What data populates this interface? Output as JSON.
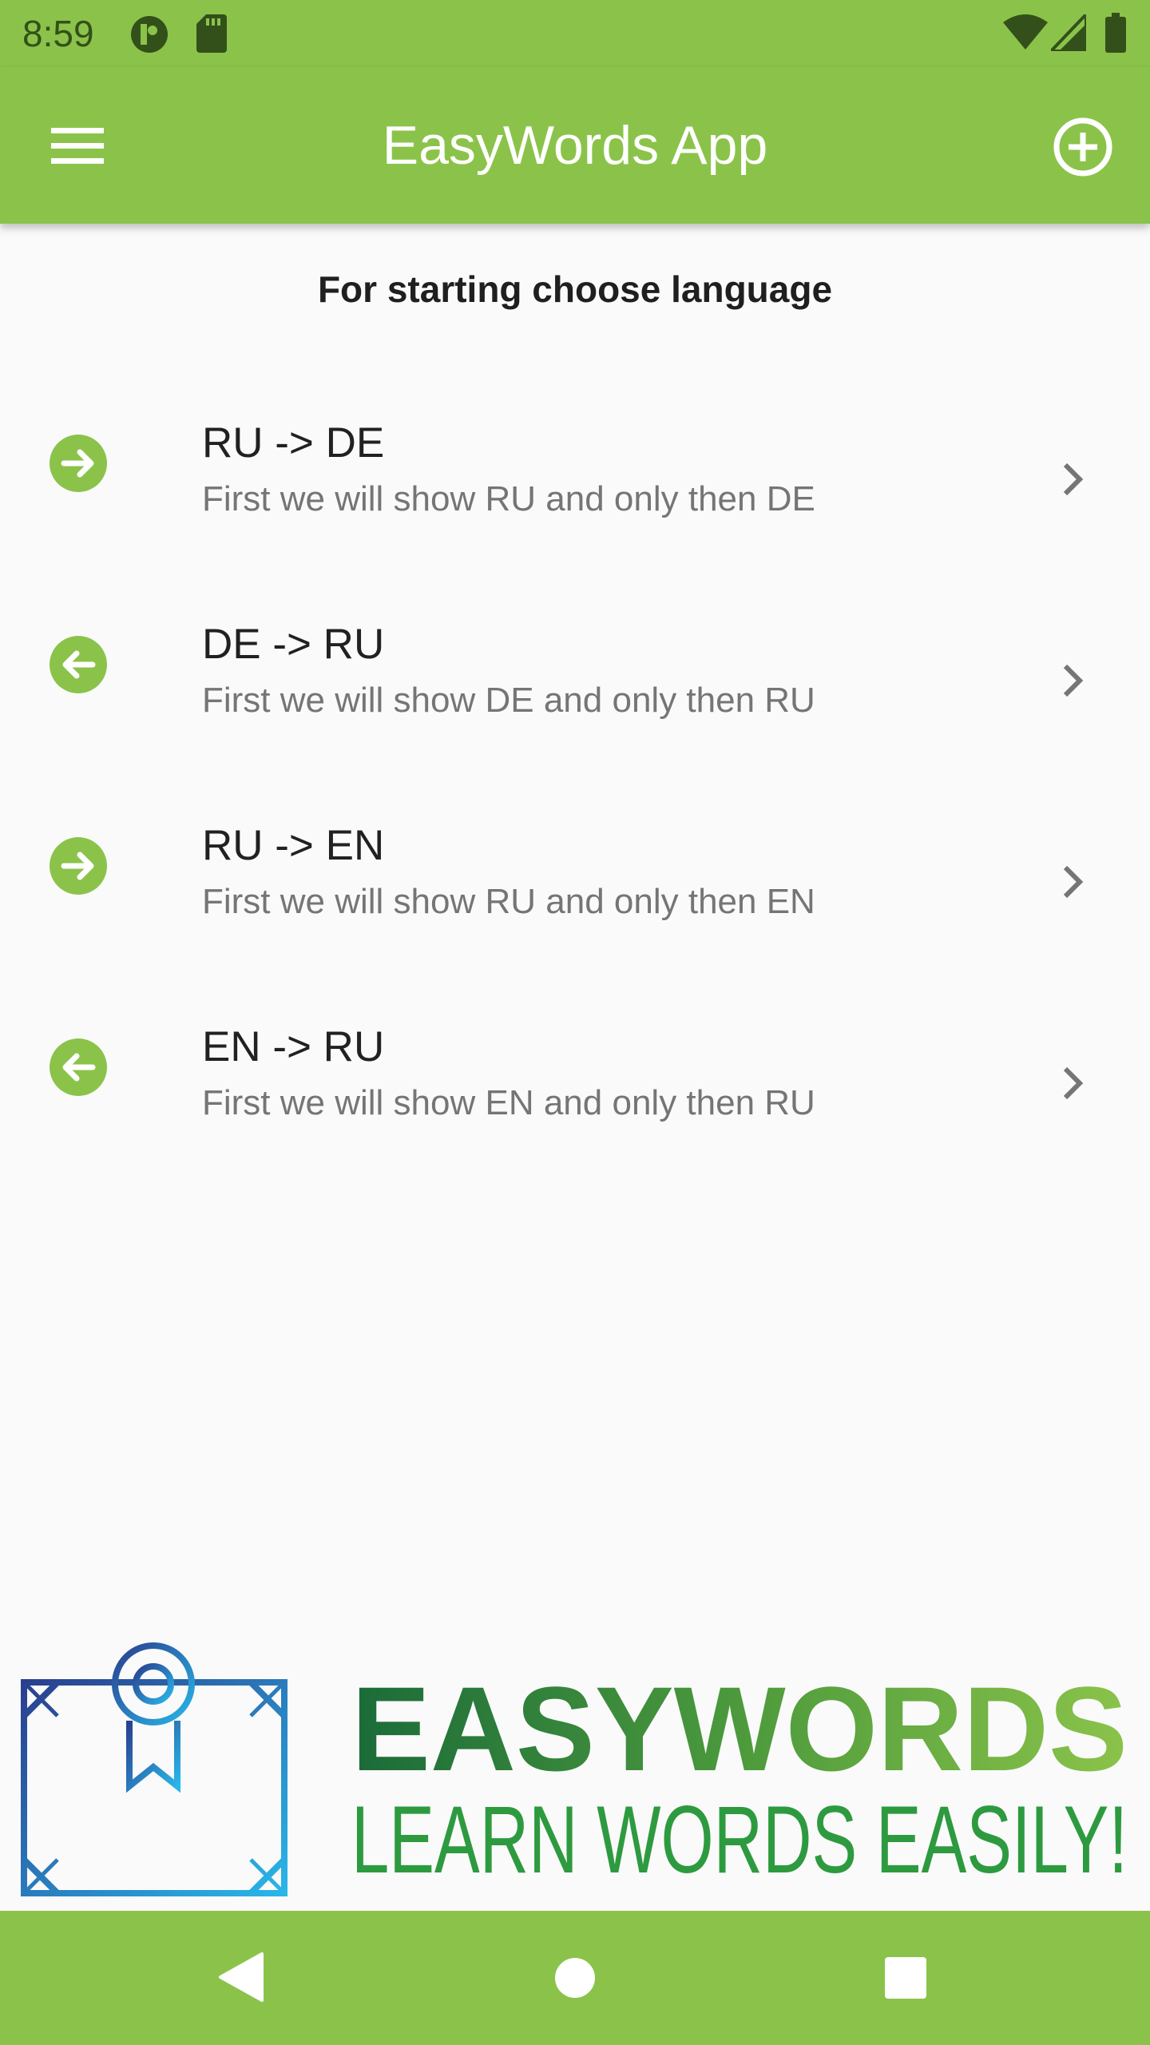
{
  "status_bar": {
    "time": "8:59",
    "icons": [
      "notification-app-icon",
      "sd-card-icon",
      "wifi-icon",
      "signal-icon",
      "battery-icon"
    ]
  },
  "app_bar": {
    "title": "EasyWords App",
    "menu_icon": "menu-icon",
    "add_icon": "add-circle-icon"
  },
  "main": {
    "heading": "For starting choose language",
    "items": [
      {
        "title": "RU -> DE",
        "subtitle": "First we will show RU and only then DE",
        "icon": "arrow-right-circle-icon"
      },
      {
        "title": "DE -> RU",
        "subtitle": "First we will show DE and only then RU",
        "icon": "arrow-left-circle-icon"
      },
      {
        "title": "RU -> EN",
        "subtitle": "First we will show RU and only then EN",
        "icon": "arrow-right-circle-icon"
      },
      {
        "title": "EN -> RU",
        "subtitle": "First we will show EN and only then RU",
        "icon": "arrow-left-circle-icon"
      }
    ]
  },
  "logo": {
    "wordmark": "EASYWORDS",
    "tagline": "LEARN WORDS EASILY!"
  },
  "nav_bar": {
    "icons": [
      "back-icon",
      "home-icon",
      "recents-icon"
    ]
  },
  "colors": {
    "primary": "#8bc34a",
    "icon_green": "#8bc34a",
    "status_icons": "#33501a",
    "wordmark_gradient": [
      "#1b6b3a",
      "#4c9a3c",
      "#8bc34a"
    ],
    "tagline": "#2e9a3f",
    "emblem_gradient": [
      "#2a3f8f",
      "#29b6e8"
    ]
  }
}
